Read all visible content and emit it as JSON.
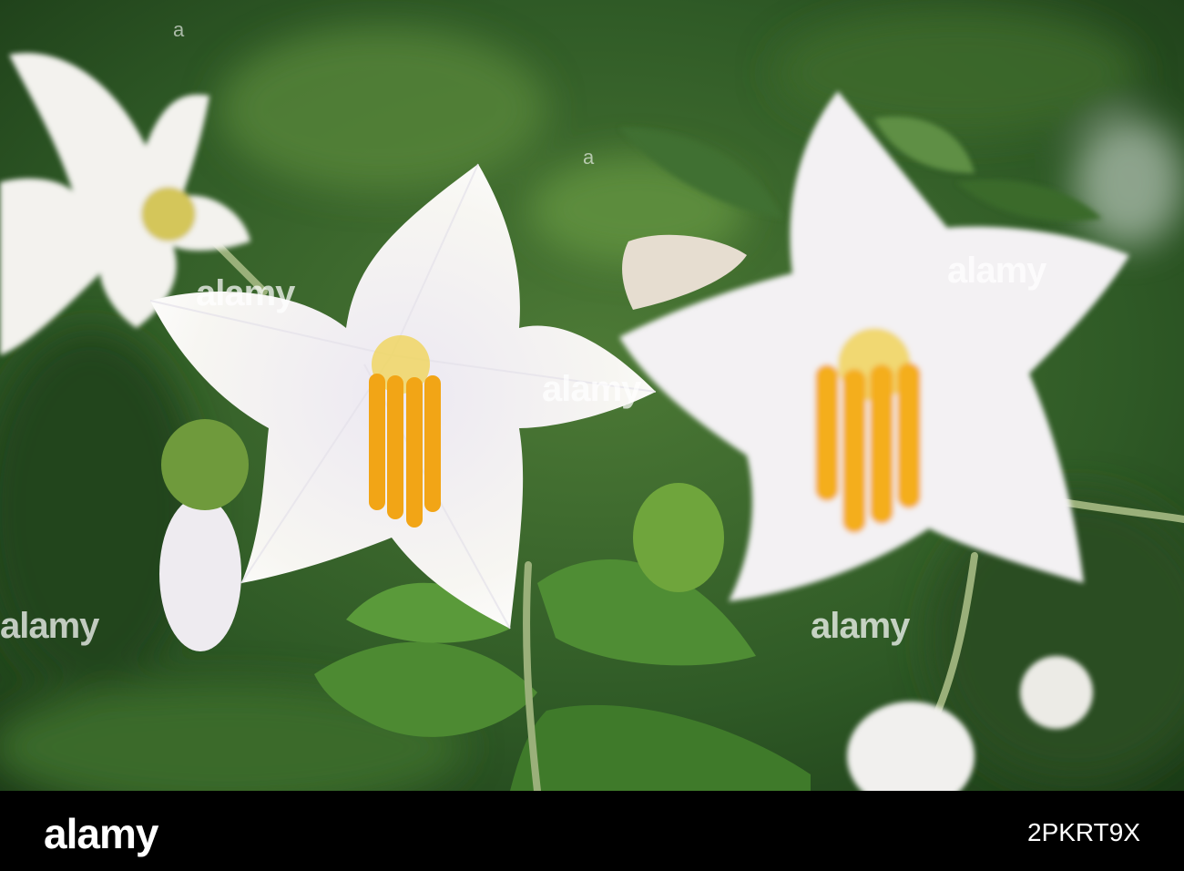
{
  "watermark": {
    "brand": "alamy",
    "image_id": "a"
  },
  "footer": {
    "logo": "alamy",
    "image_id": "2PKRT9X"
  },
  "colors": {
    "background_green": "#2f5a26",
    "petal_white": "#f4f3ef",
    "stamen_orange": "#f2a516",
    "footer_black": "#000000"
  }
}
